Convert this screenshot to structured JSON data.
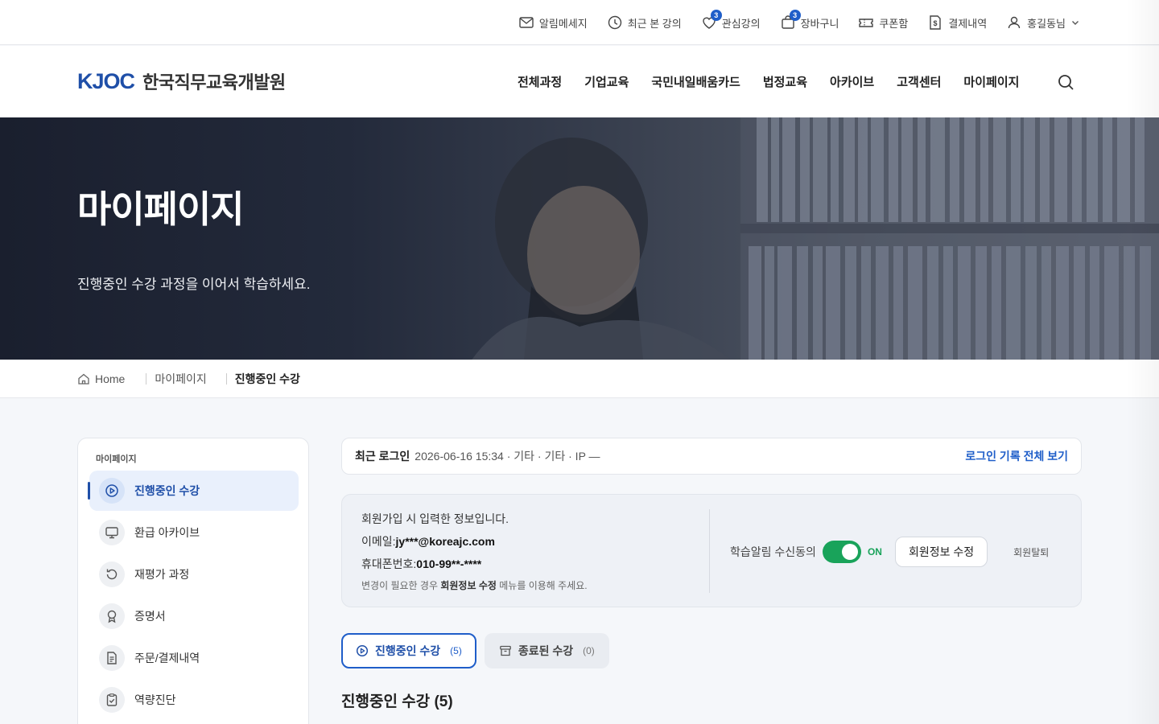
{
  "utility": {
    "items": [
      {
        "label": "알림메세지",
        "icon": "mail-icon"
      },
      {
        "label": "최근 본 강의",
        "icon": "clock-icon"
      },
      {
        "label": "관심강의",
        "icon": "heart-icon",
        "badge": "3"
      },
      {
        "label": "장바구니",
        "icon": "bag-icon",
        "badge": "3"
      },
      {
        "label": "쿠폰함",
        "icon": "ticket-icon"
      },
      {
        "label": "결제내역",
        "icon": "receipt-icon"
      },
      {
        "label": "홍길동님",
        "icon": "user-icon"
      }
    ]
  },
  "header": {
    "logo_mark": "KJOC",
    "logo_text": "한국직무교육개발원",
    "nav": [
      "전체과정",
      "기업교육",
      "국민내일배움카드",
      "법정교육",
      "아카이브",
      "고객센터",
      "마이페이지"
    ]
  },
  "hero": {
    "title": "마이페이지",
    "subtitle": "진행중인 수강 과정을 이어서 학습하세요."
  },
  "breadcrumb": {
    "home": "Home",
    "level1": "마이페이지",
    "current": "진행중인 수강"
  },
  "sidebar": {
    "title": "마이페이지",
    "items": [
      {
        "label": "진행중인 수강",
        "icon": "play-circle-icon",
        "active": true
      },
      {
        "label": "환급 아카이브",
        "icon": "monitor-icon"
      },
      {
        "label": "재평가 과정",
        "icon": "refresh-icon"
      },
      {
        "label": "증명서",
        "icon": "award-icon"
      },
      {
        "label": "주문/결제내역",
        "icon": "document-icon"
      },
      {
        "label": "역량진단",
        "icon": "clipboard-icon"
      }
    ]
  },
  "login": {
    "label": "최근 로그인",
    "info": "2026-06-16 15:34 · 기타 · 기타 · IP —",
    "link": "로그인 기록 전체 보기"
  },
  "member": {
    "intro": "회원가입 시 입력한 정보입니다.",
    "email_label": "이메일: ",
    "email": "jy***@koreajc.com",
    "phone_label": "휴대폰번호: ",
    "phone": "010-99**-****",
    "note_prefix": "변경이 필요한 경우 ",
    "note_strong": "회원정보 수정",
    "note_suffix": " 메뉴를 이용해 주세요.",
    "consent_label": "학습알림 수신동의",
    "consent_state": "ON",
    "edit_button": "회원정보 수정",
    "withdraw": "회원탈퇴"
  },
  "tabs": [
    {
      "label": "진행중인 수강",
      "count": "(5)",
      "active": true,
      "icon": "play-circle-icon"
    },
    {
      "label": "종료된 수강",
      "count": "(0)",
      "active": false,
      "icon": "archive-icon"
    }
  ],
  "section_title": "진행중인 수강 (5)",
  "colors": {
    "primary": "#1f5ec9",
    "brand_navy": "#1f4fa8",
    "toggle_on": "#19a35a"
  }
}
